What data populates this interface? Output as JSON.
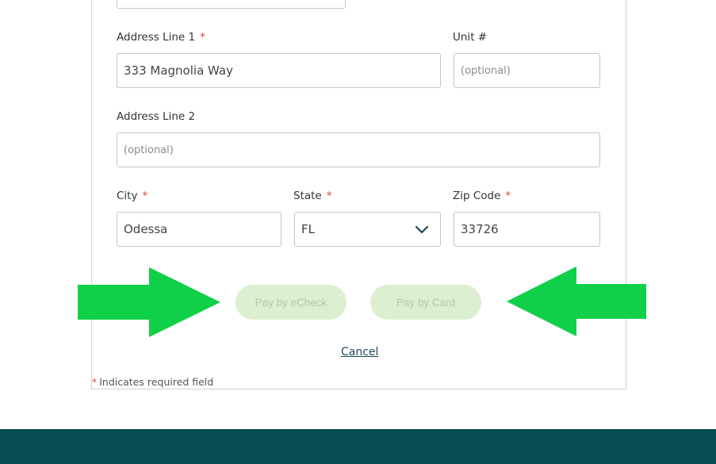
{
  "form": {
    "address1": {
      "label": "Address Line 1",
      "required_mark": "*",
      "value": "333 Magnolia Way"
    },
    "unit": {
      "label": "Unit #",
      "placeholder": "(optional)"
    },
    "address2": {
      "label": "Address Line 2",
      "placeholder": "(optional)"
    },
    "city": {
      "label": "City",
      "required_mark": "*",
      "value": "Odessa"
    },
    "state": {
      "label": "State",
      "required_mark": "*",
      "value": "FL"
    },
    "zip": {
      "label": "Zip Code",
      "required_mark": "*",
      "value": "33726"
    }
  },
  "actions": {
    "pay_echeck": "Pay by eCheck",
    "pay_card": "Pay by Card",
    "cancel": "Cancel"
  },
  "required_note": {
    "mark": "*",
    "text": "Indicates required field"
  },
  "colors": {
    "arrow": "#0fd048",
    "button_bg": "#dcefd0",
    "button_text": "#b5c7ab",
    "required": "#e0443c",
    "footer": "#064d55",
    "link": "#1c4a5a"
  },
  "icons": {
    "state_dropdown": "chevron-down-icon"
  }
}
